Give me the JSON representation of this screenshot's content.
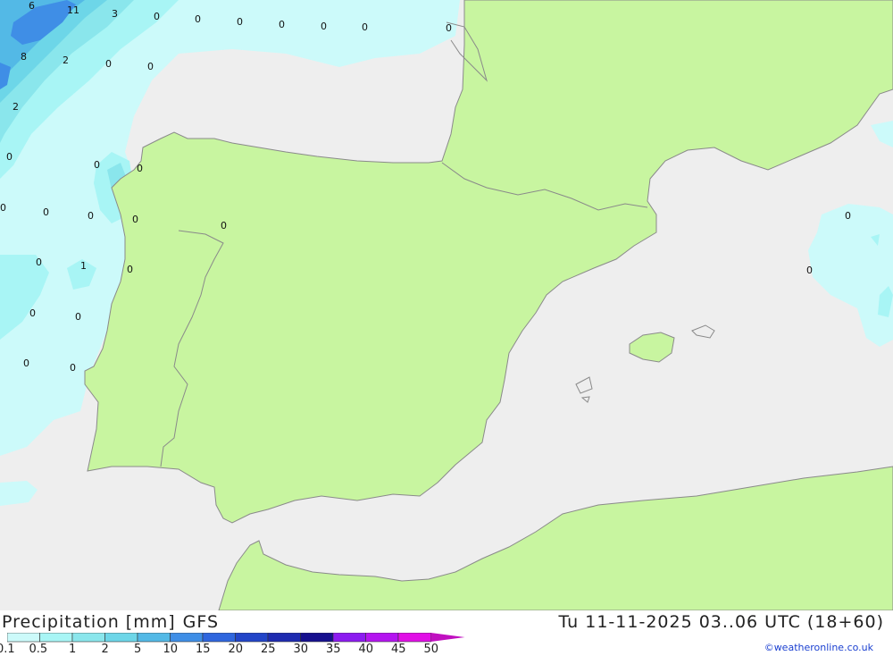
{
  "header": {
    "title": "Precipitation [mm]",
    "model": "GFS",
    "datetime": "Tu 11-11-2025 03..06 UTC (18+60)",
    "credit": "©weatheronline.co.uk"
  },
  "legend": {
    "levels": [
      "0.1",
      "0.5",
      "1",
      "2",
      "5",
      "10",
      "15",
      "20",
      "25",
      "30",
      "35",
      "40",
      "45",
      "50"
    ],
    "colors": [
      "#ccfafa",
      "#a8f5f5",
      "#8ae6ec",
      "#6dd6e8",
      "#53b9e6",
      "#3f8ee6",
      "#2f66de",
      "#2245c8",
      "#1e2bb0",
      "#16108e",
      "#8c1bf0",
      "#b414f0",
      "#e10fe6",
      "#c010c0"
    ]
  },
  "map": {
    "land_color": "#c8f5a0",
    "sea_color": "#eeeeee",
    "border_color": "#888888",
    "values": [
      {
        "text": "6"
      },
      {
        "text": "11"
      },
      {
        "text": "3"
      },
      {
        "text": "0"
      },
      {
        "text": "0"
      },
      {
        "text": "0"
      },
      {
        "text": "0"
      },
      {
        "text": "0"
      },
      {
        "text": "0"
      },
      {
        "text": "0"
      },
      {
        "text": "8"
      },
      {
        "text": "2"
      },
      {
        "text": "0"
      },
      {
        "text": "0"
      },
      {
        "text": "2"
      },
      {
        "text": "0"
      },
      {
        "text": "0"
      },
      {
        "text": "0"
      },
      {
        "text": "0"
      },
      {
        "text": "0"
      },
      {
        "text": "0"
      },
      {
        "text": "0"
      },
      {
        "text": "0"
      },
      {
        "text": "0"
      },
      {
        "text": "1"
      },
      {
        "text": "0"
      },
      {
        "text": "0"
      },
      {
        "text": "0"
      },
      {
        "text": "0"
      },
      {
        "text": "0"
      },
      {
        "text": "0"
      },
      {
        "text": "0"
      }
    ]
  }
}
